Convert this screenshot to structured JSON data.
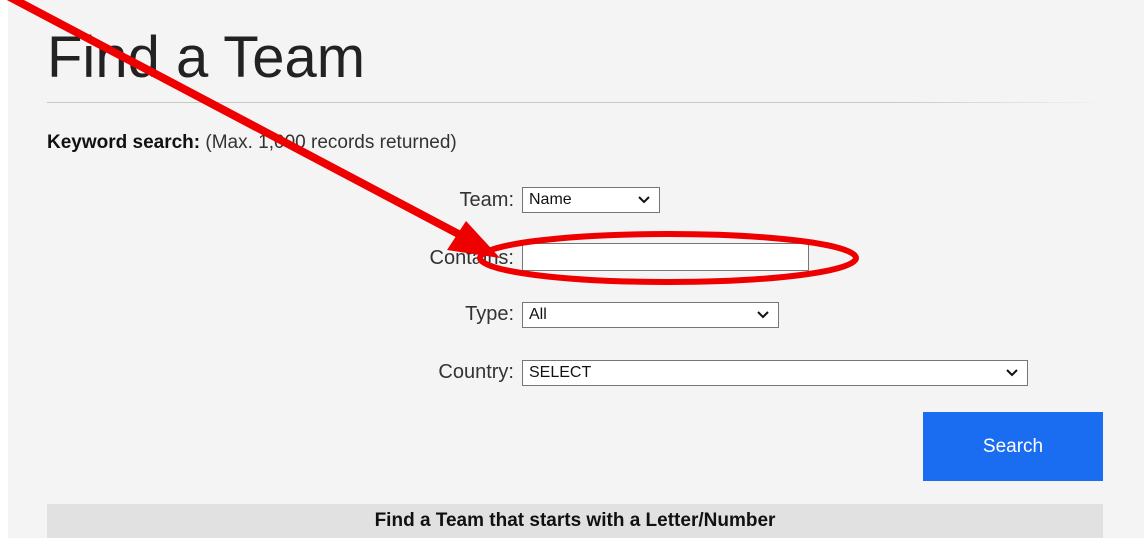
{
  "page": {
    "title": "Find a Team"
  },
  "keyword_search": {
    "label": "Keyword search:",
    "note": "(Max. 1,000 records returned)"
  },
  "form": {
    "team": {
      "label": "Team:",
      "selected": "Name"
    },
    "contains": {
      "label": "Contains:",
      "value": "",
      "placeholder": ""
    },
    "type": {
      "label": "Type:",
      "selected": "All"
    },
    "country": {
      "label": "Country:",
      "selected": "SELECT"
    },
    "search_label": "Search"
  },
  "letter_section": {
    "heading": "Find a Team that starts with a Letter/Number"
  },
  "colors": {
    "accent_button": "#1a6cf0",
    "annotation": "#ee0000",
    "panel_background": "#f4f4f4",
    "section_bar": "#e1e1e1"
  },
  "annotation": {
    "arrow_icon": "red-arrow",
    "highlight_icon": "red-ellipse"
  }
}
